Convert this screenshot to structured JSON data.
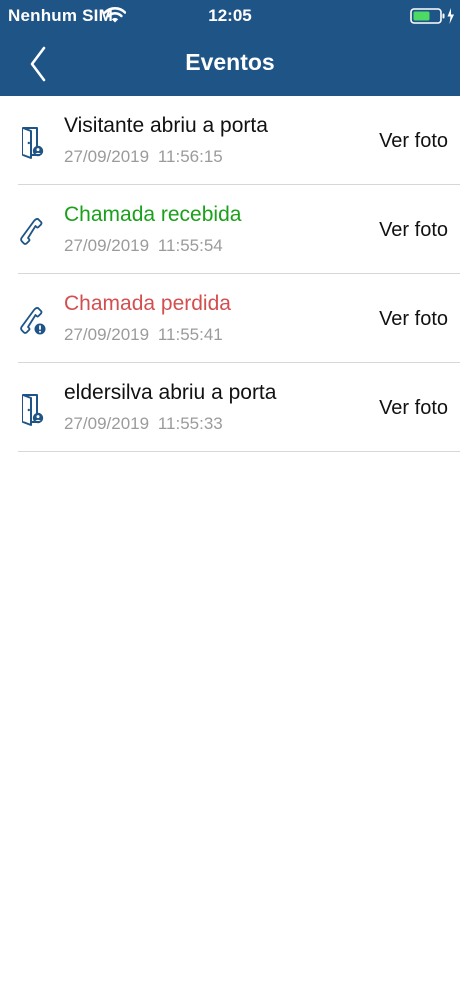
{
  "status_bar": {
    "carrier": "Nenhum SIM",
    "time": "12:05"
  },
  "header": {
    "title": "Eventos",
    "back_icon": "chevron-left-icon",
    "background_color": "#1f5486"
  },
  "events": [
    {
      "icon": "door-visitor-icon",
      "title": "Visitante abriu a porta",
      "date": "27/09/2019",
      "time": "11:56:15",
      "action": "Ver foto"
    },
    {
      "icon": "phone-icon",
      "title": "Chamada recebida",
      "title_color": "#1aa01a",
      "date": "27/09/2019",
      "time": "11:55:54",
      "action": "Ver foto"
    },
    {
      "icon": "phone-missed-icon",
      "title": "Chamada perdida",
      "title_color": "#d34f4f",
      "date": "27/09/2019",
      "time": "11:55:41",
      "action": "Ver foto"
    },
    {
      "icon": "door-user-icon",
      "title": "eldersilva abriu a porta",
      "date": "27/09/2019",
      "time": "11:55:33",
      "action": "Ver foto"
    }
  ]
}
